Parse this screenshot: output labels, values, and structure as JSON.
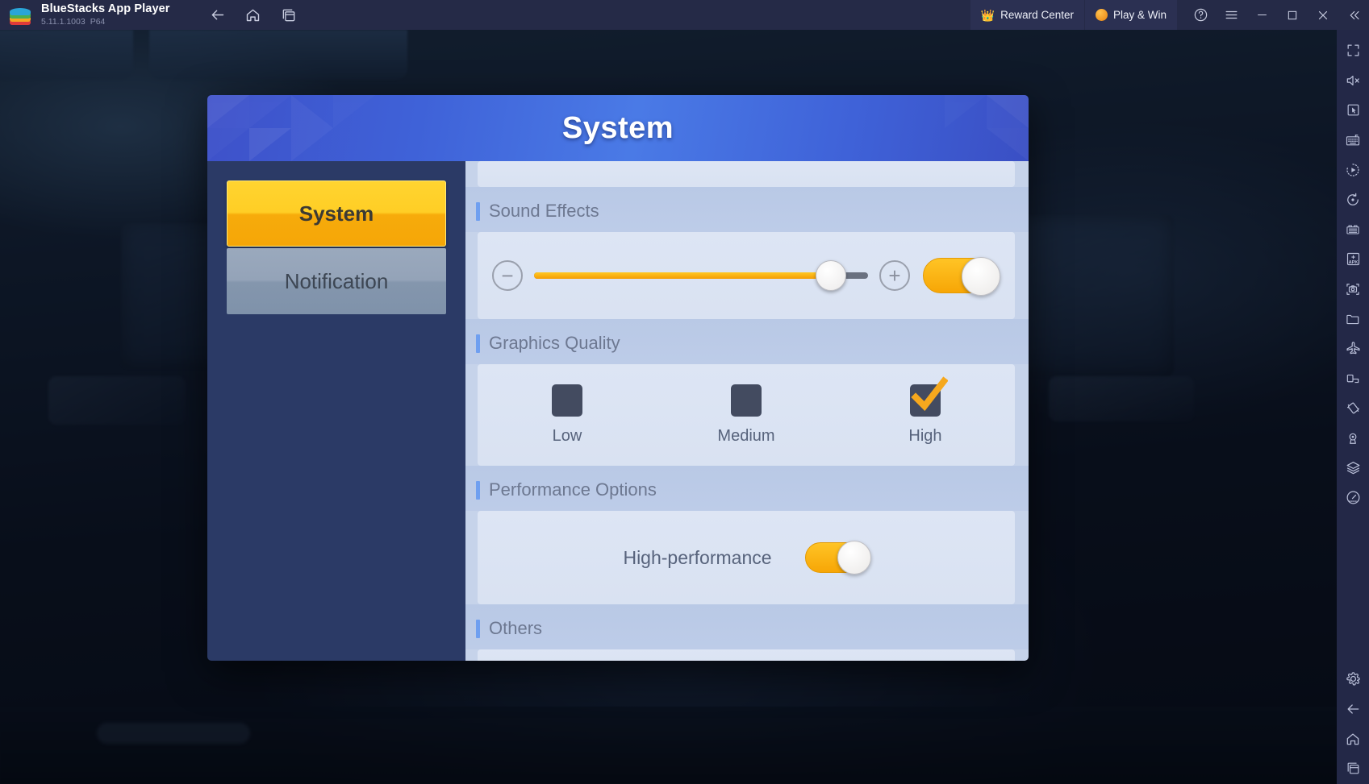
{
  "window": {
    "app_title": "BlueStacks App Player",
    "version": "5.11.1.1003",
    "build": "P64",
    "nav": [
      {
        "name": "back-icon",
        "label": "Back"
      },
      {
        "name": "home-icon",
        "label": "Home"
      },
      {
        "name": "recents-icon",
        "label": "Recent apps"
      }
    ],
    "reward_center": "Reward Center",
    "play_and_win": "Play & Win",
    "controls": [
      {
        "name": "help-button",
        "label": "Help"
      },
      {
        "name": "menu-button",
        "label": "Menu"
      },
      {
        "name": "minimize-button",
        "label": "Minimize"
      },
      {
        "name": "maximize-button",
        "label": "Maximize"
      },
      {
        "name": "close-button",
        "label": "Close"
      },
      {
        "name": "collapse-sidebar-button",
        "label": "Collapse"
      }
    ]
  },
  "sidebar": {
    "items": [
      {
        "name": "fullscreen-icon",
        "label": "Full screen"
      },
      {
        "name": "mute-icon",
        "label": "Mute"
      },
      {
        "name": "cursor-icon",
        "label": "Game controls"
      },
      {
        "name": "keyboard-icon",
        "label": "Keyboard controls"
      },
      {
        "name": "macro-icon",
        "label": "Macro recorder"
      },
      {
        "name": "rotate-icon",
        "label": "Rotate"
      },
      {
        "name": "multi-instance-icon",
        "label": "Multi-instance manager"
      },
      {
        "name": "install-apk-icon",
        "label": "Install APK"
      },
      {
        "name": "screenshot-icon",
        "label": "Screenshot"
      },
      {
        "name": "media-folder-icon",
        "label": "Media manager"
      },
      {
        "name": "eco-mode-icon",
        "label": "Eco mode"
      },
      {
        "name": "real-time-translation-icon",
        "label": "Real-time translation"
      },
      {
        "name": "shake-icon",
        "label": "Shake"
      },
      {
        "name": "location-icon",
        "label": "Location"
      },
      {
        "name": "layers-icon",
        "label": "Layers"
      },
      {
        "name": "performance-meter-icon",
        "label": "Performance"
      },
      {
        "name": "settings-gear-icon",
        "label": "Settings"
      },
      {
        "name": "android-back-icon",
        "label": "Back"
      },
      {
        "name": "android-home-icon",
        "label": "Home"
      },
      {
        "name": "android-recents-icon",
        "label": "Recent apps"
      }
    ]
  },
  "dialog": {
    "title": "System",
    "tabs": [
      {
        "label": "System",
        "active": true
      },
      {
        "label": "Notification",
        "active": false
      }
    ],
    "sections": [
      {
        "key": "sound_effects",
        "title": "Sound Effects",
        "slider": {
          "value": 100,
          "min": 0,
          "max": 100,
          "fill_percent": 89
        },
        "decrease_label": "−",
        "increase_label": "+",
        "toggle_on": true
      },
      {
        "key": "graphics_quality",
        "title": "Graphics Quality",
        "options": [
          {
            "label": "Low",
            "checked": false
          },
          {
            "label": "Medium",
            "checked": false
          },
          {
            "label": "High",
            "checked": true
          }
        ]
      },
      {
        "key": "performance_options",
        "title": "Performance Options",
        "rows": [
          {
            "label": "High-performance",
            "toggle_on": true
          }
        ]
      },
      {
        "key": "others",
        "title": "Others"
      }
    ]
  },
  "colors": {
    "accent_amber": "#ffc425",
    "accent_amber_dark": "#f7a606",
    "header_blue": "#4a7ae6",
    "section_bar_blue": "#6f9ff0",
    "panel_bg": "#dde5f4",
    "rail_bg": "#2b3a66",
    "checkbox_bg": "#434b60",
    "chrome_bg": "#252a47"
  }
}
